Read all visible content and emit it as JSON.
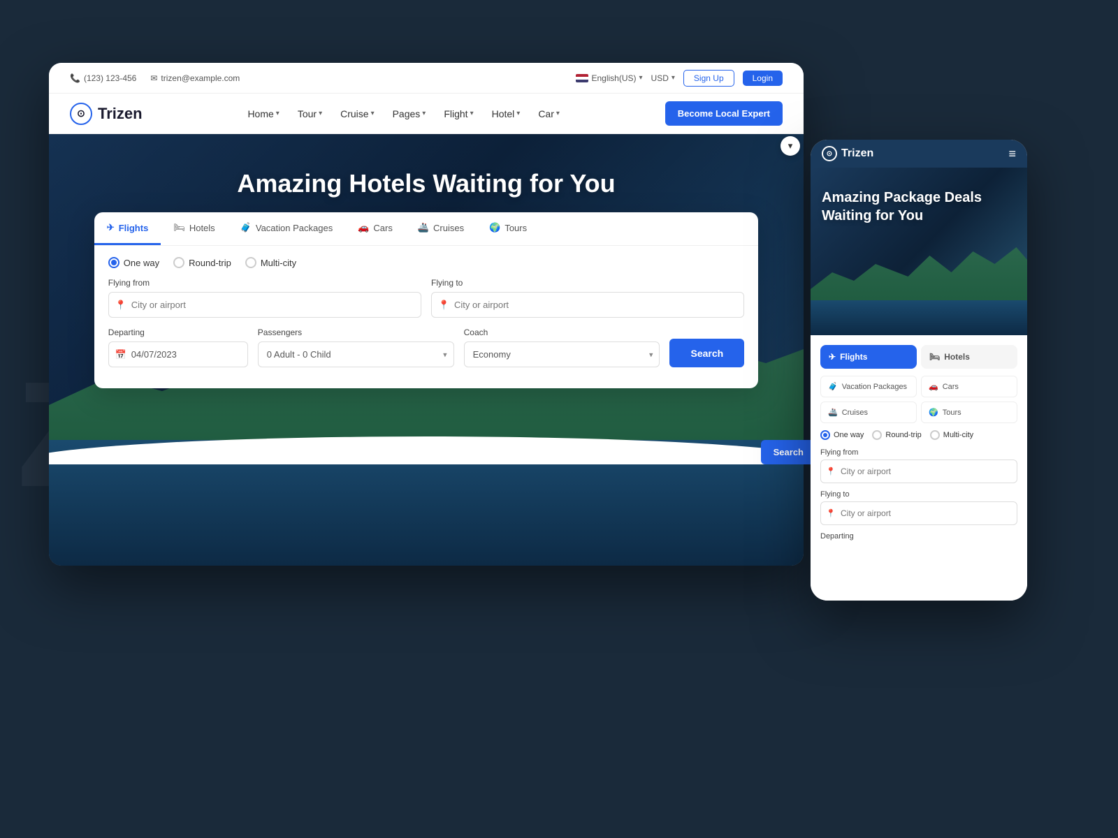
{
  "background": {
    "letters": "zin"
  },
  "topbar": {
    "phone": "(123) 123-456",
    "email": "trizen@example.com",
    "language": "English(US)",
    "currency": "USD",
    "signup_label": "Sign Up",
    "login_label": "Login"
  },
  "navbar": {
    "logo_text": "Trizen",
    "nav_items": [
      {
        "label": "Home",
        "has_dropdown": true
      },
      {
        "label": "Tour",
        "has_dropdown": true
      },
      {
        "label": "Cruise",
        "has_dropdown": true
      },
      {
        "label": "Pages",
        "has_dropdown": true
      },
      {
        "label": "Flight",
        "has_dropdown": true
      },
      {
        "label": "Hotel",
        "has_dropdown": true
      },
      {
        "label": "Car",
        "has_dropdown": true
      }
    ],
    "cta_label": "Become Local Expert"
  },
  "hero": {
    "title": "Amazing Hotels Waiting for You"
  },
  "search": {
    "tabs": [
      {
        "label": "Flights",
        "icon": "✈",
        "active": true
      },
      {
        "label": "Hotels",
        "icon": "🏨",
        "active": false
      },
      {
        "label": "Vacation Packages",
        "icon": "🧳",
        "active": false
      },
      {
        "label": "Cars",
        "icon": "🚗",
        "active": false
      },
      {
        "label": "Cruises",
        "icon": "🚢",
        "active": false
      },
      {
        "label": "Tours",
        "icon": "🌍",
        "active": false
      }
    ],
    "trip_options": [
      {
        "label": "One way",
        "selected": true
      },
      {
        "label": "Round-trip",
        "selected": false
      },
      {
        "label": "Multi-city",
        "selected": false
      }
    ],
    "flying_from_label": "Flying from",
    "flying_from_placeholder": "City or airport",
    "flying_to_label": "Flying to",
    "flying_to_placeholder": "City or airport",
    "departing_label": "Departing",
    "departing_value": "04/07/2023",
    "passengers_label": "Passengers",
    "passengers_value": "0 Adult - 0 Child",
    "coach_label": "Coach",
    "coach_value": "Economy",
    "search_label": "Search"
  },
  "mobile": {
    "logo_text": "Trizen",
    "hamburger_icon": "≡",
    "hero_title": "Amazing Package Deals Waiting for You",
    "tabs": [
      {
        "label": "Flights",
        "icon": "✈",
        "active": true
      },
      {
        "label": "Hotels",
        "icon": "🏨",
        "active": false
      }
    ],
    "sub_tabs": [
      {
        "label": "Vacation Packages",
        "icon": "🧳"
      },
      {
        "label": "Cars",
        "icon": "🚗"
      },
      {
        "label": "Cruises",
        "icon": "🚢"
      },
      {
        "label": "Tours",
        "icon": "🌍"
      }
    ],
    "trip_options": [
      {
        "label": "One way",
        "selected": true
      },
      {
        "label": "Round-trip",
        "selected": false
      },
      {
        "label": "Multi-city",
        "selected": false
      }
    ],
    "flying_from_label": "Flying from",
    "flying_from_placeholder": "City or airport",
    "flying_to_label": "Flying to",
    "flying_to_placeholder": "City or airport",
    "departing_label": "Departing"
  }
}
